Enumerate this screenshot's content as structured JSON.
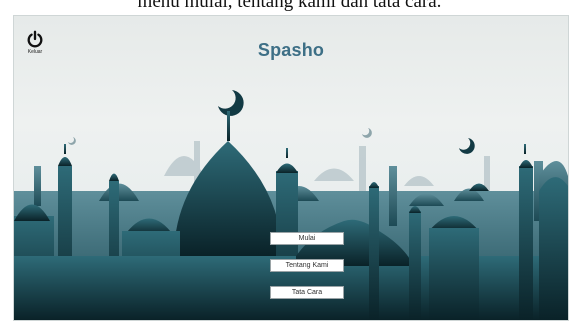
{
  "caption": "menu mulai, tentang kami dan tata cara.",
  "app": {
    "title": "Spasho",
    "exit_label": "Keluar"
  },
  "menu": {
    "start": "Mulai",
    "about": "Tentang Kami",
    "how_to": "Tata Cara"
  },
  "colors": {
    "title": "#3d6f86",
    "silhouette_dark": "#0e2e36",
    "silhouette_mid": "#1f5563",
    "silhouette_light": "#9fb2b8"
  },
  "icons": [
    "power-icon",
    "crescent-icon"
  ]
}
